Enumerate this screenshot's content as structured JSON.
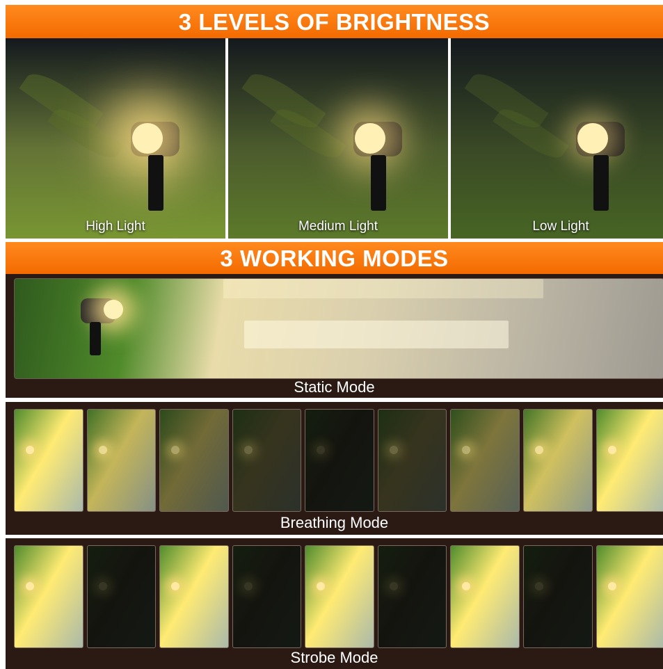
{
  "brightness": {
    "title": "3 LEVELS OF BRIGHTNESS",
    "levels": [
      {
        "label": "High Light",
        "intensity": 1.0
      },
      {
        "label": "Medium Light",
        "intensity": 0.6
      },
      {
        "label": "Low Light",
        "intensity": 0.3
      }
    ]
  },
  "modes": {
    "title": "3 WORKING MODES",
    "static_label": "Static Mode",
    "breathing_label": "Breathing Mode",
    "strobe_label": "Strobe Mode",
    "breathing_frames": [
      1.0,
      0.75,
      0.4,
      0.15,
      0.0,
      0.15,
      0.45,
      0.8,
      1.0
    ],
    "strobe_frames": [
      1,
      0,
      1,
      0,
      1,
      0,
      1,
      0,
      1
    ]
  },
  "colors": {
    "banner": "#f36a00",
    "mode_background": "#2b1a14",
    "light": "#ffe9a3"
  }
}
